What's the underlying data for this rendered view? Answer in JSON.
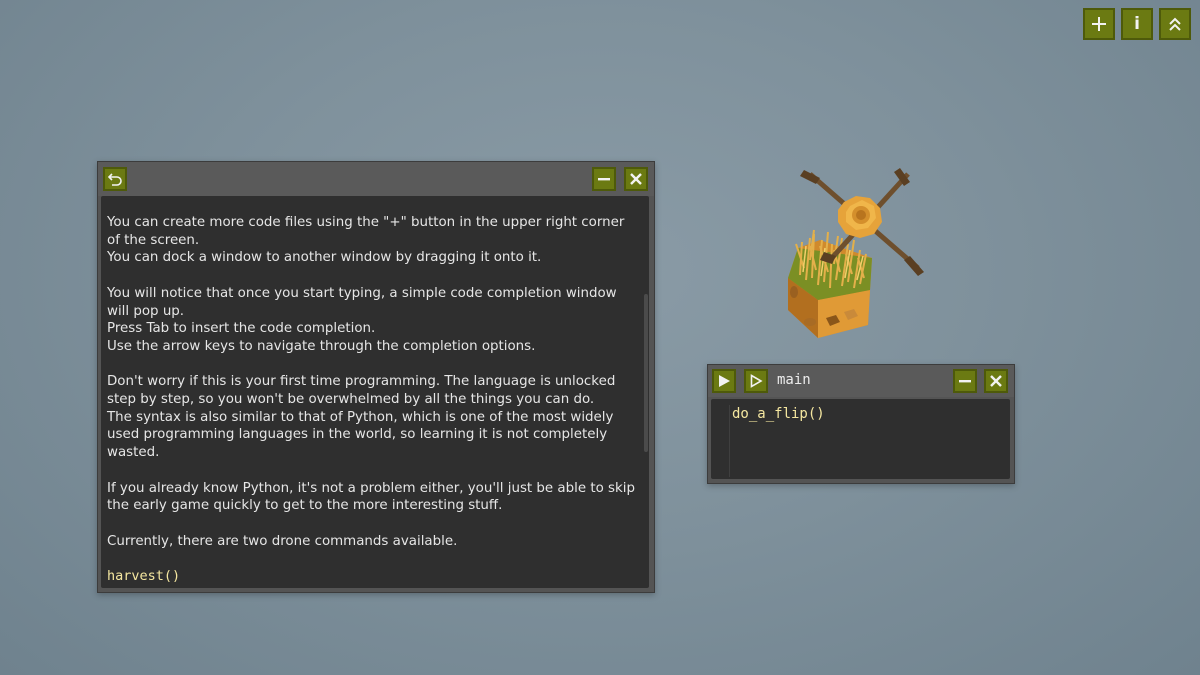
{
  "topbar": {
    "add_icon": "plus-icon",
    "info_label": "i",
    "collapse_icon": "double-chevron-up-icon"
  },
  "docs_window": {
    "back_icon": "back-arrow-icon",
    "minimize_icon": "minimize-icon",
    "close_icon": "close-icon",
    "paragraphs": [
      [
        "You can create more code files using the \"+\" button in the upper right corner of the screen.",
        "You can dock a window to another window by dragging it onto it."
      ],
      [
        "You will notice that once you start typing, a simple code completion window will pop up.",
        "Press Tab to insert the code completion.",
        "Use the arrow keys to navigate through the completion options."
      ],
      [
        "Don't worry if this is your first time programming. The language is unlocked step by step, so you won't be overwhelmed by all the things you can do.",
        "The syntax is also similar to that of Python, which is one of the most widely used programming languages in the world, so learning it is not completely wasted."
      ],
      [
        "If you already know Python, it's not a problem either, you'll just be able to skip the early game quickly to get to the more interesting stuff."
      ],
      [
        "Currently, there are two drone commands available."
      ]
    ],
    "code_snippet": "harvest()"
  },
  "code_window": {
    "title": "main",
    "run_icon": "play-icon",
    "step_icon": "play-outline-icon",
    "minimize_icon": "minimize-icon",
    "close_icon": "close-icon",
    "code": "do_a_flip()"
  },
  "colors": {
    "button_bg": "#6b7a12",
    "window_bg": "#545454",
    "panel_bg": "#2f2f2f",
    "code_text": "#f5e7a0",
    "background": "#7f919c"
  }
}
